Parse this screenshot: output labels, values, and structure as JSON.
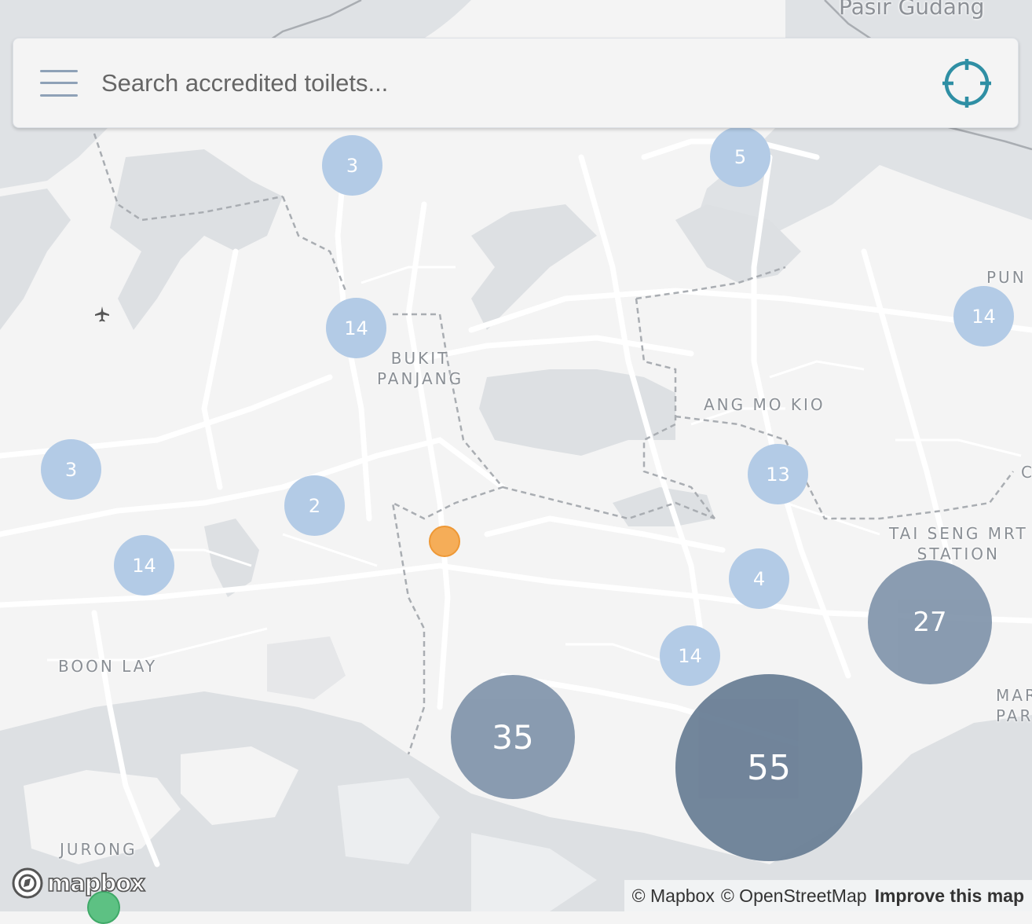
{
  "search": {
    "placeholder": "Search accredited toilets..."
  },
  "places": {
    "pasir_gudang": "Pasir Gudang",
    "bukit_panjang": "BUKIT\nPANJANG",
    "ang_mo_kio": "ANG MO KIO",
    "boon_lay": "BOON LAY",
    "tai_seng": "TAI SENG MRT\nSTATION",
    "jurong": "JURONG",
    "pung": "PUN",
    "mar": "MAR\nPAR",
    "c_edge": "C"
  },
  "clusters": [
    {
      "id": "3-north",
      "count": "3"
    },
    {
      "id": "5-north",
      "count": "5"
    },
    {
      "id": "14-bukit",
      "count": "14"
    },
    {
      "id": "14-punggol",
      "count": "14"
    },
    {
      "id": "3-west",
      "count": "3"
    },
    {
      "id": "2-west",
      "count": "2"
    },
    {
      "id": "13-angmokio",
      "count": "13"
    },
    {
      "id": "14-west",
      "count": "14"
    },
    {
      "id": "4-central",
      "count": "4"
    },
    {
      "id": "27-east",
      "count": "27"
    },
    {
      "id": "14-south",
      "count": "14"
    },
    {
      "id": "35-south",
      "count": "35"
    },
    {
      "id": "55-south",
      "count": "55"
    }
  ],
  "colors": {
    "small_cluster": "#b3cbe6",
    "medium_cluster": "#8497ad",
    "large_cluster": "#6a7f96",
    "single_marker": "#f5ad58",
    "green_marker": "#5dc183",
    "locate_icon": "#2f8fa4",
    "water": "#dde0e3",
    "land": "#f4f4f4",
    "road": "#ffffff"
  },
  "attribution": {
    "mapbox": "© Mapbox",
    "osm": "© OpenStreetMap",
    "improve": "Improve this map"
  },
  "logo": {
    "wordmark": "mapbox"
  },
  "icons": {
    "menu": "menu-icon",
    "locate": "crosshair-icon",
    "airport": "airplane-icon"
  }
}
